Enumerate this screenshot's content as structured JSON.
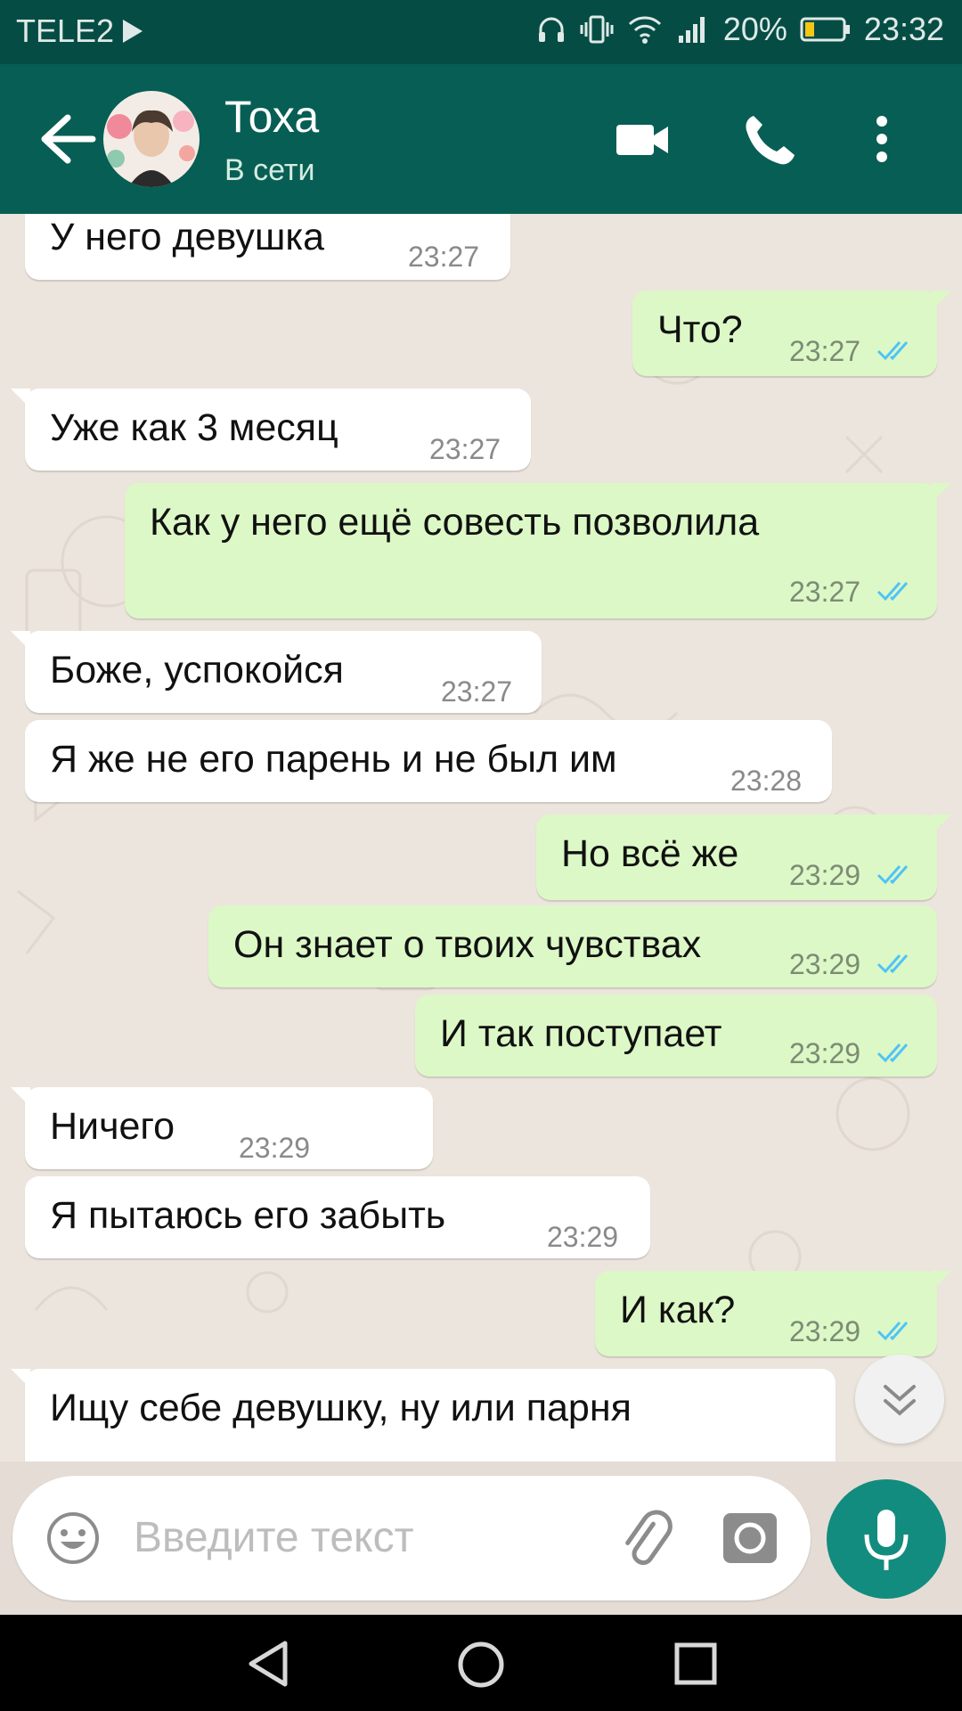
{
  "status": {
    "carrier": "TELE2",
    "battery": "20%",
    "time": "23:32"
  },
  "header": {
    "name": "Тоха",
    "status": "В сети"
  },
  "messages": [
    {
      "dir": "in",
      "text": "У него девушка",
      "time": "23:27"
    },
    {
      "dir": "out",
      "text": "Что?",
      "time": "23:27"
    },
    {
      "dir": "in",
      "text": "Уже как 3 месяц",
      "time": "23:27"
    },
    {
      "dir": "out",
      "text": "Как у него ещё совесть позволила",
      "time": "23:27"
    },
    {
      "dir": "in",
      "text": "Боже, успокойся",
      "time": "23:27"
    },
    {
      "dir": "in",
      "text": "Я же не его парень и не был им",
      "time": "23:28"
    },
    {
      "dir": "out",
      "text": "Но всё же",
      "time": "23:29"
    },
    {
      "dir": "out",
      "text": "Он знает о твоих чувствах",
      "time": "23:29"
    },
    {
      "dir": "out",
      "text": "И так поступает",
      "time": "23:29"
    },
    {
      "dir": "in",
      "text": "Ничего",
      "time": "23:29"
    },
    {
      "dir": "in",
      "text": "Я пытаюсь его забыть",
      "time": "23:29"
    },
    {
      "dir": "out",
      "text": "И как?",
      "time": "23:29"
    },
    {
      "dir": "in",
      "text": "Ищу себе девушку, ну или парня",
      "time": ""
    }
  ],
  "composer": {
    "placeholder": "Введите текст"
  },
  "colors": {
    "header": "#075e54",
    "statusbar": "#054d44",
    "outgoing": "#dcf8c6",
    "incoming": "#ffffff",
    "ticks": "#4fc3f7",
    "mic": "#128c7e"
  }
}
